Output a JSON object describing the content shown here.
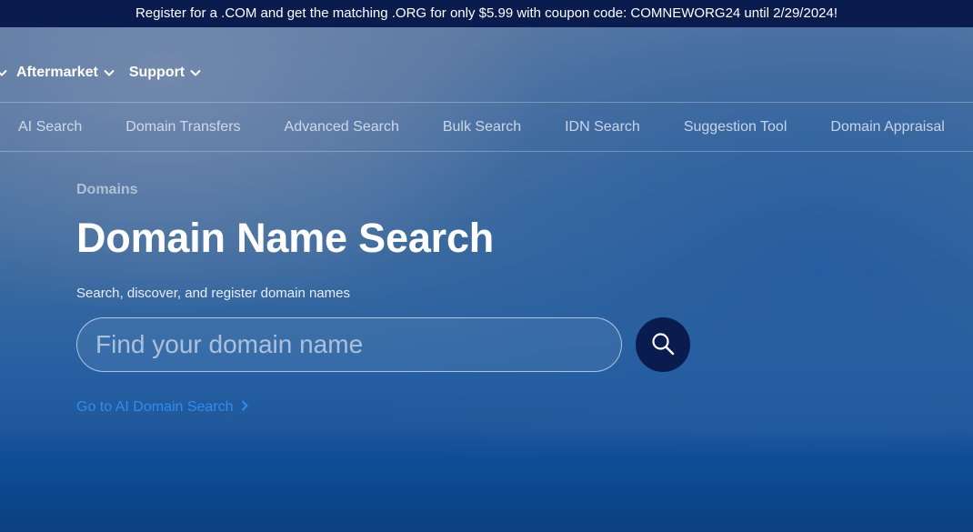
{
  "promo_banner": {
    "text": "Register for a .COM and get the matching .ORG for only $5.99 with coupon code: COMNEWORG24 until 2/29/2024!"
  },
  "top_nav": {
    "items": [
      {
        "label": "Aftermarket"
      },
      {
        "label": "Support"
      }
    ]
  },
  "sub_nav": {
    "items": [
      {
        "label": "AI Search"
      },
      {
        "label": "Domain Transfers"
      },
      {
        "label": "Advanced Search"
      },
      {
        "label": "Bulk Search"
      },
      {
        "label": "IDN Search"
      },
      {
        "label": "Suggestion Tool"
      },
      {
        "label": "Domain Appraisal"
      }
    ]
  },
  "hero": {
    "eyebrow": "Domains",
    "title": "Domain Name Search",
    "subtitle": "Search, discover, and register domain names",
    "search": {
      "placeholder": "Find your domain name",
      "value": ""
    },
    "ai_link_label": "Go to AI Domain Search"
  },
  "colors": {
    "banner_bg": "#0a1b4e",
    "search_button_bg": "#0a1b4e",
    "link": "#2f8cf0",
    "text_primary": "#ffffff"
  },
  "icons": {
    "search_button": "search-icon",
    "dropdown": "chevron-down-icon",
    "link_arrow": "chevron-right-icon"
  }
}
